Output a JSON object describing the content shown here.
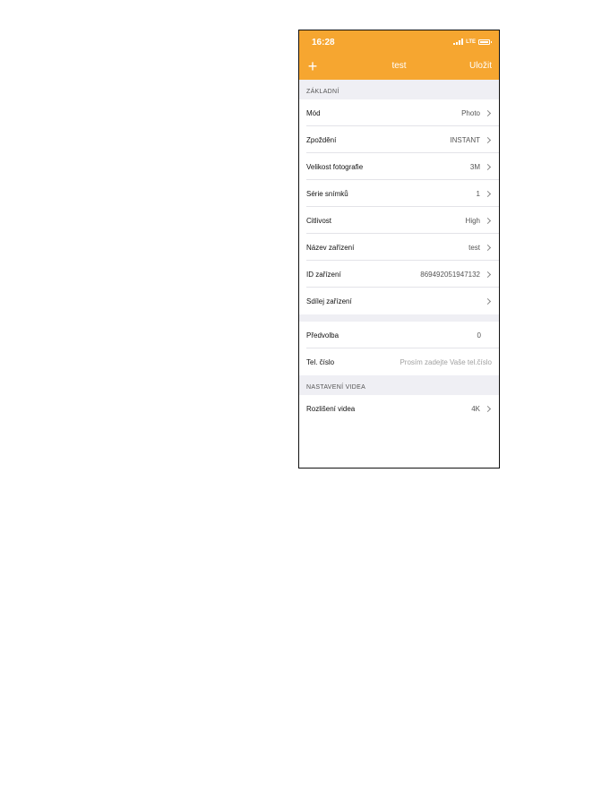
{
  "status_bar": {
    "time": "16:28",
    "network": "LTE"
  },
  "nav": {
    "add_label": "+",
    "title": "test",
    "save_label": "Uložit"
  },
  "basic_section": {
    "header": "ZÁKLADNÍ",
    "rows": [
      {
        "label": "Mód",
        "value": "Photo"
      },
      {
        "label": "Zpoždění",
        "value": "INSTANT"
      },
      {
        "label": "Velikost fotografie",
        "value": "3M"
      },
      {
        "label": "Série snímků",
        "value": "1"
      },
      {
        "label": "Citlivost",
        "value": "High"
      },
      {
        "label": "Název zařízení",
        "value": "test"
      },
      {
        "label": "ID zařízení",
        "value": "869492051947132"
      },
      {
        "label": "Sdílej zařízení",
        "value": ""
      }
    ]
  },
  "preset": {
    "label": "Předvolba",
    "value": "0"
  },
  "phone": {
    "label": "Tel. číslo",
    "placeholder": "Prosím zadejte Vaše tel.číslo"
  },
  "video_section": {
    "header": "NASTAVENÍ VIDEA",
    "rows": [
      {
        "label": "Rozlišení videa",
        "value": "4K"
      }
    ]
  },
  "colors": {
    "accent": "#f6a630",
    "section_background": "#efeff4"
  }
}
